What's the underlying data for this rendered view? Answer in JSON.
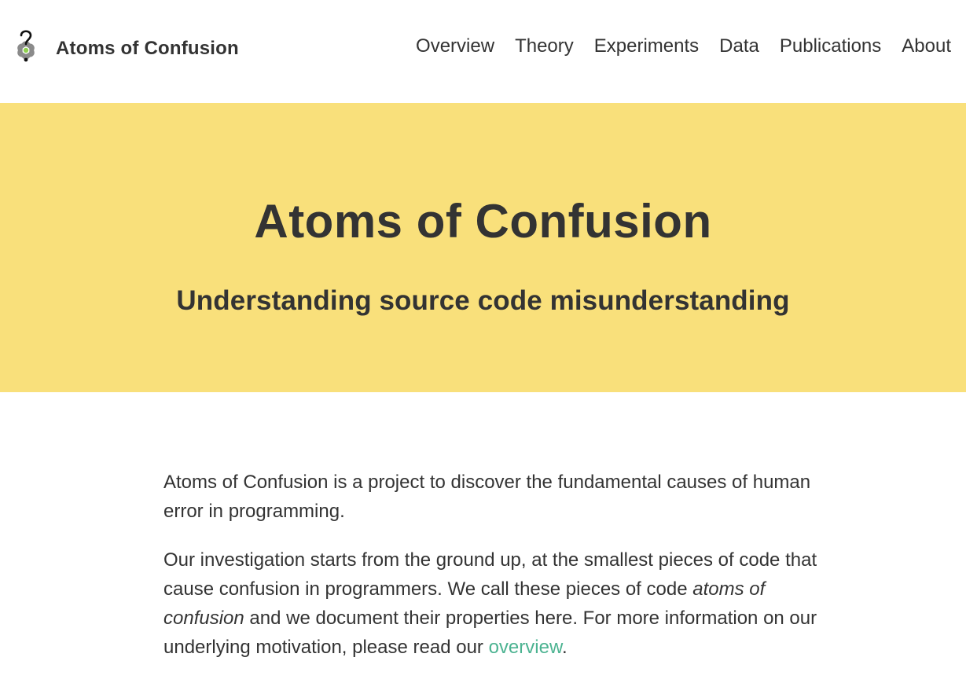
{
  "header": {
    "brand_name": "Atoms of Confusion",
    "nav": [
      {
        "label": "Overview"
      },
      {
        "label": "Theory"
      },
      {
        "label": "Experiments"
      },
      {
        "label": "Data"
      },
      {
        "label": "Publications"
      },
      {
        "label": "About"
      }
    ]
  },
  "hero": {
    "title": "Atoms of Confusion",
    "subtitle": "Understanding source code misunderstanding",
    "background_color": "#f9e07b"
  },
  "content": {
    "paragraph1": "Atoms of Confusion is a project to discover the fundamental causes of human error in programming.",
    "paragraph2_part1": "Our investigation starts from the ground up, at the smallest pieces of code that cause confusion in programmers. We call these pieces of code ",
    "paragraph2_emphasis": "atoms of confusion",
    "paragraph2_part2": " and we document their properties here. For more information on our underlying motivation, please read our ",
    "paragraph2_link": "overview",
    "paragraph2_end": ".",
    "link_color": "#4cb391"
  }
}
